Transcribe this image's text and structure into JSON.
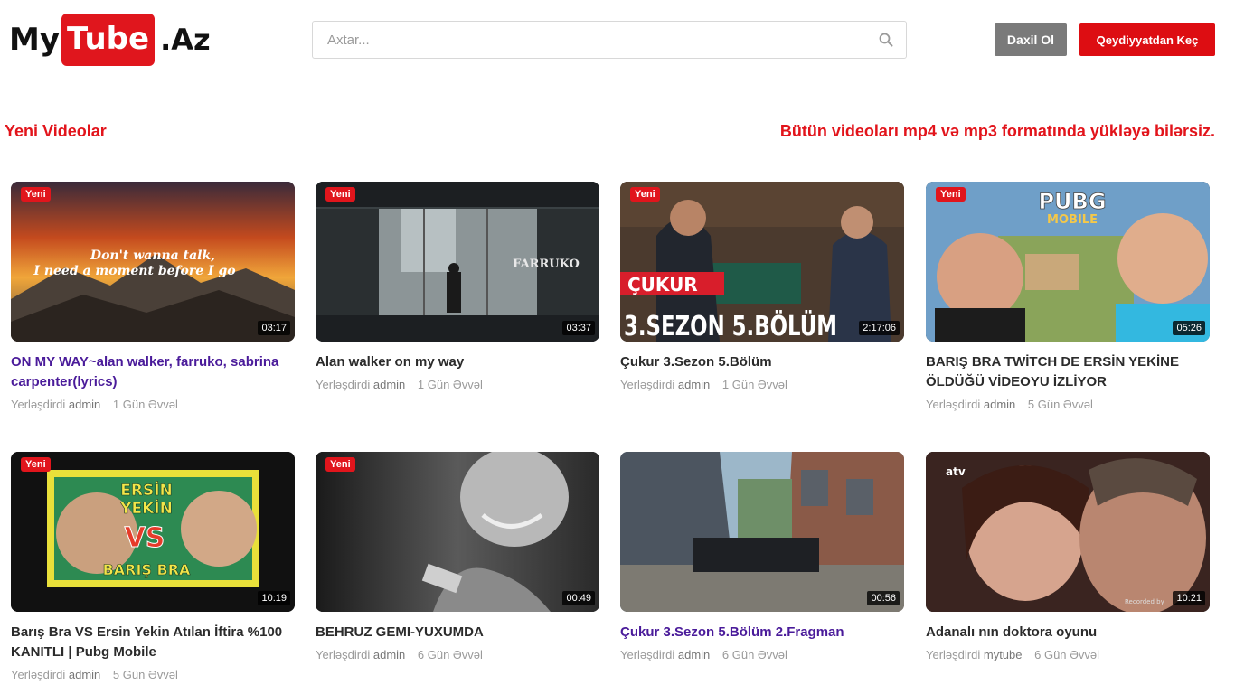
{
  "brand": {
    "my": "My",
    "tube": "Tube",
    "az": ".Az"
  },
  "search": {
    "placeholder": "Axtar..."
  },
  "auth": {
    "login": "Daxil Ol",
    "register": "Qeydiyyatdan Keç"
  },
  "section": {
    "title": "Yeni Videolar",
    "notice": "Bütün videoları mp4 və mp3 formatında yükləyə bilərsiz."
  },
  "labels": {
    "posted_by": "Yerləşdirdi",
    "new_badge": "Yeni"
  },
  "colors": {
    "accent": "#e2141b",
    "visited_link": "#4a1b9a",
    "login_button": "#7a7a7a"
  },
  "videos": [
    {
      "title": "ON MY WAY~alan walker, farruko, sabrina carpenter(lyrics)",
      "author": "admin",
      "time": "1 Gün Əvvəl",
      "duration": "03:17",
      "is_new": true,
      "visited": true,
      "thumb_text": [
        "Don't wanna talk,",
        "I need a moment before I go"
      ]
    },
    {
      "title": "Alan walker on my way",
      "author": "admin",
      "time": "1 Gün Əvvəl",
      "duration": "03:37",
      "is_new": true,
      "visited": false,
      "thumb_text": [
        "FARRUKO"
      ]
    },
    {
      "title": "Çukur 3.Sezon 5.Bölüm",
      "author": "admin",
      "time": "1 Gün Əvvəl",
      "duration": "2:17:06",
      "is_new": true,
      "visited": false,
      "thumb_text": [
        "ÇUKUR",
        "3.SEZON 5.BÖLÜM"
      ]
    },
    {
      "title": "BARIŞ BRA TWİTCH DE ERSİN YEKİNE ÖLDÜĞÜ VİDEOYU İZLİYOR",
      "author": "admin",
      "time": "5 Gün Əvvəl",
      "duration": "05:26",
      "is_new": true,
      "visited": false,
      "thumb_text": [
        "PUBG",
        "MOBILE"
      ]
    },
    {
      "title": "Barış Bra VS Ersin Yekin Atılan İftira %100 KANITLI | Pubg Mobile",
      "author": "admin",
      "time": "5 Gün Əvvəl",
      "duration": "10:19",
      "is_new": true,
      "visited": false,
      "thumb_text": [
        "ERSİN",
        "YEKİN",
        "VS",
        "BARIŞ BRA"
      ]
    },
    {
      "title": "BEHRUZ GEMI-YUXUMDA",
      "author": "admin",
      "time": "6 Gün Əvvəl",
      "duration": "00:49",
      "is_new": true,
      "visited": false,
      "thumb_text": []
    },
    {
      "title": "Çukur 3.Sezon 5.Bölüm 2.Fragman",
      "author": "admin",
      "time": "6 Gün Əvvəl",
      "duration": "00:56",
      "is_new": false,
      "visited": true,
      "thumb_text": []
    },
    {
      "title": "Adanalı nın doktora oyunu",
      "author": "mytube",
      "time": "6 Gün Əvvəl",
      "duration": "10:21",
      "is_new": false,
      "visited": false,
      "thumb_text": [
        "atv",
        "Recorded by"
      ]
    }
  ]
}
